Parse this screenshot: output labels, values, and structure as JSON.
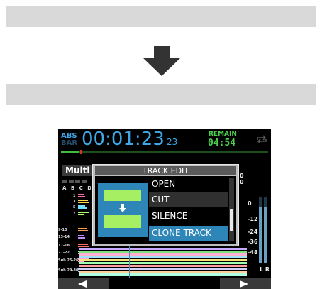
{
  "screen": {
    "abs_label": "ABS",
    "bar_label": "BAR",
    "time": "00:01:23",
    "time_frames": "23",
    "remain_label": "REMAIN",
    "remain_value": "04:54",
    "progress": 0.09,
    "mode_tab": "Multi",
    "track_columns": "A B C D",
    "track_labels": [
      "1",
      "3",
      "5",
      "7",
      "9-10",
      "13-14",
      "17-18",
      "21-22",
      "Sub 25-26",
      "Sub 29-30"
    ],
    "right_scale_top": [
      "0",
      "0"
    ],
    "right_scale": [
      "0",
      "-12",
      "-24",
      "-36",
      "-48"
    ],
    "lr_label": "L R"
  },
  "dialog": {
    "title": "TRACK EDIT",
    "items": [
      {
        "label": "OPEN",
        "selected": false
      },
      {
        "label": "CUT",
        "selected": false
      },
      {
        "label": "SILENCE",
        "selected": false
      },
      {
        "label": "CLONE TRACK",
        "selected": true
      }
    ]
  },
  "colors": {
    "accent_blue": "#3fa8e8",
    "remain_green": "#4ed04e",
    "selection": "#2e86b8",
    "illustration_green": "#a6ef63"
  },
  "icons": {
    "down_arrow": "down-arrow-icon",
    "loop": "loop-icon",
    "prev": "left-triangle-icon",
    "next": "right-triangle-icon"
  }
}
